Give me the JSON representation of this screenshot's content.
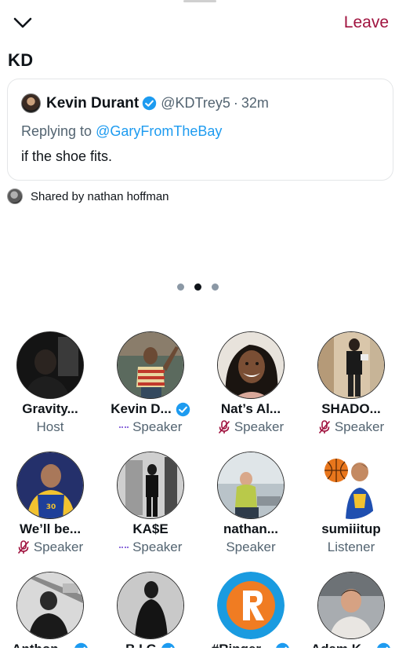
{
  "header": {
    "leave_label": "Leave",
    "title": "KD"
  },
  "tweet": {
    "author_name": "Kevin Durant",
    "author_handle": "@KDTrey5",
    "separator": "·",
    "time": "32m",
    "replying_prefix": "Replying to",
    "replying_to": "@GaryFromTheBay",
    "text": "if the shoe fits."
  },
  "shared": {
    "text": "Shared by nathan hoffman"
  },
  "pager": {
    "active_page": 2,
    "total_pages": 3
  },
  "participants": [
    {
      "name": "Gravity...",
      "role": "Host",
      "verified": false,
      "mic": "none",
      "avatar": "dark-figure"
    },
    {
      "name": "Kevin D...",
      "role": "Speaker",
      "verified": true,
      "mic": "speaking",
      "avatar": "striped-shirt"
    },
    {
      "name": "Nat’s Al...",
      "role": "Speaker",
      "verified": false,
      "mic": "muted",
      "avatar": "smiling-woman"
    },
    {
      "name": "SHADO...",
      "role": "Speaker",
      "verified": false,
      "mic": "muted",
      "avatar": "mirror-selfie"
    },
    {
      "name": "We’ll be...",
      "role": "Speaker",
      "verified": false,
      "mic": "muted",
      "avatar": "basketball-player"
    },
    {
      "name": "KA$E",
      "role": "Speaker",
      "verified": false,
      "mic": "speaking",
      "avatar": "bw-standing"
    },
    {
      "name": "nathan...",
      "role": "Speaker",
      "verified": false,
      "mic": "none",
      "avatar": "seated-man"
    },
    {
      "name": "sumiiitup",
      "role": "Listener",
      "verified": false,
      "mic": "none",
      "avatar": "cartoon-baller"
    }
  ],
  "partial_row": [
    {
      "name": "Anthon...",
      "verified": true
    },
    {
      "name": "B.I.G",
      "verified": true
    },
    {
      "name": "#Ringer...",
      "verified": true
    },
    {
      "name": "Adam K...",
      "verified": true
    }
  ],
  "colors": {
    "leave": "#a0133f",
    "link": "#1d9bf0",
    "muted_text": "#536471",
    "verified": "#1d9bf0",
    "speaking_bars": "#6b3fd1",
    "mic_muted": "#a0133f"
  }
}
